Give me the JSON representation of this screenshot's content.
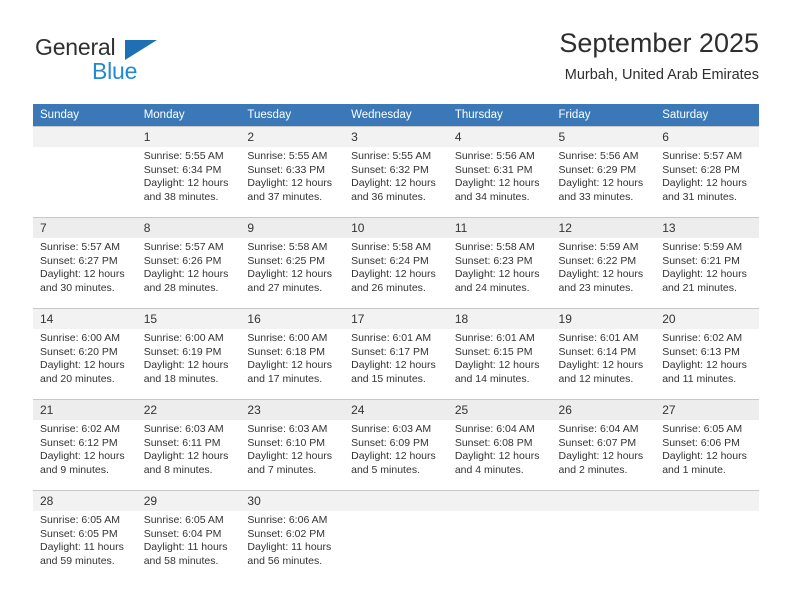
{
  "brand": {
    "name_part1": "General",
    "name_part2": "Blue",
    "accent_color": "#2389d4",
    "triangle_color": "#1f6fb5"
  },
  "header": {
    "month_title": "September 2025",
    "location": "Murbah, United Arab Emirates"
  },
  "calendar": {
    "header_background": "#3b78b7",
    "weekdays": [
      "Sunday",
      "Monday",
      "Tuesday",
      "Wednesday",
      "Thursday",
      "Friday",
      "Saturday"
    ],
    "weeks": [
      [
        {
          "day": "",
          "details": ""
        },
        {
          "day": "1",
          "details": "Sunrise: 5:55 AM\nSunset: 6:34 PM\nDaylight: 12 hours\nand 38 minutes."
        },
        {
          "day": "2",
          "details": "Sunrise: 5:55 AM\nSunset: 6:33 PM\nDaylight: 12 hours\nand 37 minutes."
        },
        {
          "day": "3",
          "details": "Sunrise: 5:55 AM\nSunset: 6:32 PM\nDaylight: 12 hours\nand 36 minutes."
        },
        {
          "day": "4",
          "details": "Sunrise: 5:56 AM\nSunset: 6:31 PM\nDaylight: 12 hours\nand 34 minutes."
        },
        {
          "day": "5",
          "details": "Sunrise: 5:56 AM\nSunset: 6:29 PM\nDaylight: 12 hours\nand 33 minutes."
        },
        {
          "day": "6",
          "details": "Sunrise: 5:57 AM\nSunset: 6:28 PM\nDaylight: 12 hours\nand 31 minutes."
        }
      ],
      [
        {
          "day": "7",
          "details": "Sunrise: 5:57 AM\nSunset: 6:27 PM\nDaylight: 12 hours\nand 30 minutes."
        },
        {
          "day": "8",
          "details": "Sunrise: 5:57 AM\nSunset: 6:26 PM\nDaylight: 12 hours\nand 28 minutes."
        },
        {
          "day": "9",
          "details": "Sunrise: 5:58 AM\nSunset: 6:25 PM\nDaylight: 12 hours\nand 27 minutes."
        },
        {
          "day": "10",
          "details": "Sunrise: 5:58 AM\nSunset: 6:24 PM\nDaylight: 12 hours\nand 26 minutes."
        },
        {
          "day": "11",
          "details": "Sunrise: 5:58 AM\nSunset: 6:23 PM\nDaylight: 12 hours\nand 24 minutes."
        },
        {
          "day": "12",
          "details": "Sunrise: 5:59 AM\nSunset: 6:22 PM\nDaylight: 12 hours\nand 23 minutes."
        },
        {
          "day": "13",
          "details": "Sunrise: 5:59 AM\nSunset: 6:21 PM\nDaylight: 12 hours\nand 21 minutes."
        }
      ],
      [
        {
          "day": "14",
          "details": "Sunrise: 6:00 AM\nSunset: 6:20 PM\nDaylight: 12 hours\nand 20 minutes."
        },
        {
          "day": "15",
          "details": "Sunrise: 6:00 AM\nSunset: 6:19 PM\nDaylight: 12 hours\nand 18 minutes."
        },
        {
          "day": "16",
          "details": "Sunrise: 6:00 AM\nSunset: 6:18 PM\nDaylight: 12 hours\nand 17 minutes."
        },
        {
          "day": "17",
          "details": "Sunrise: 6:01 AM\nSunset: 6:17 PM\nDaylight: 12 hours\nand 15 minutes."
        },
        {
          "day": "18",
          "details": "Sunrise: 6:01 AM\nSunset: 6:15 PM\nDaylight: 12 hours\nand 14 minutes."
        },
        {
          "day": "19",
          "details": "Sunrise: 6:01 AM\nSunset: 6:14 PM\nDaylight: 12 hours\nand 12 minutes."
        },
        {
          "day": "20",
          "details": "Sunrise: 6:02 AM\nSunset: 6:13 PM\nDaylight: 12 hours\nand 11 minutes."
        }
      ],
      [
        {
          "day": "21",
          "details": "Sunrise: 6:02 AM\nSunset: 6:12 PM\nDaylight: 12 hours\nand 9 minutes."
        },
        {
          "day": "22",
          "details": "Sunrise: 6:03 AM\nSunset: 6:11 PM\nDaylight: 12 hours\nand 8 minutes."
        },
        {
          "day": "23",
          "details": "Sunrise: 6:03 AM\nSunset: 6:10 PM\nDaylight: 12 hours\nand 7 minutes."
        },
        {
          "day": "24",
          "details": "Sunrise: 6:03 AM\nSunset: 6:09 PM\nDaylight: 12 hours\nand 5 minutes."
        },
        {
          "day": "25",
          "details": "Sunrise: 6:04 AM\nSunset: 6:08 PM\nDaylight: 12 hours\nand 4 minutes."
        },
        {
          "day": "26",
          "details": "Sunrise: 6:04 AM\nSunset: 6:07 PM\nDaylight: 12 hours\nand 2 minutes."
        },
        {
          "day": "27",
          "details": "Sunrise: 6:05 AM\nSunset: 6:06 PM\nDaylight: 12 hours\nand 1 minute."
        }
      ],
      [
        {
          "day": "28",
          "details": "Sunrise: 6:05 AM\nSunset: 6:05 PM\nDaylight: 11 hours\nand 59 minutes."
        },
        {
          "day": "29",
          "details": "Sunrise: 6:05 AM\nSunset: 6:04 PM\nDaylight: 11 hours\nand 58 minutes."
        },
        {
          "day": "30",
          "details": "Sunrise: 6:06 AM\nSunset: 6:02 PM\nDaylight: 11 hours\nand 56 minutes."
        },
        {
          "day": "",
          "details": ""
        },
        {
          "day": "",
          "details": ""
        },
        {
          "day": "",
          "details": ""
        },
        {
          "day": "",
          "details": ""
        }
      ]
    ]
  }
}
